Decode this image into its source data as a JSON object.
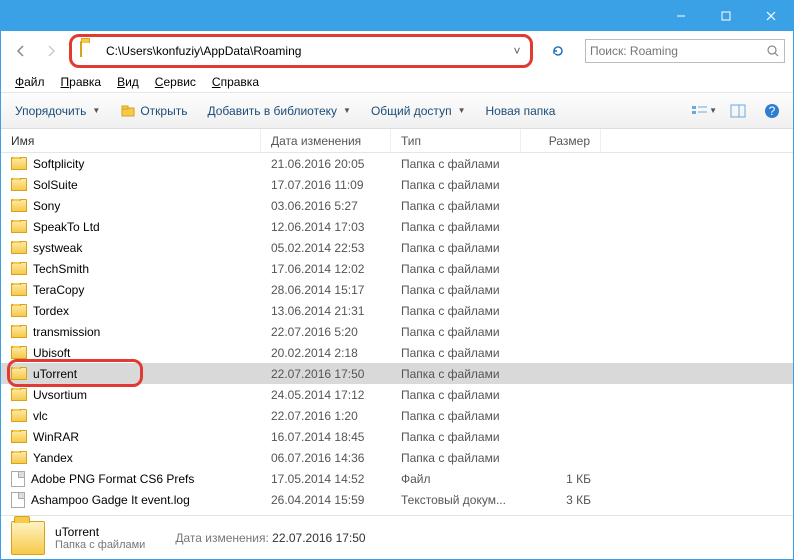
{
  "address": "C:\\Users\\konfuziy\\AppData\\Roaming",
  "search_placeholder": "Поиск: Roaming",
  "menu": {
    "file": "Файл",
    "edit": "Правка",
    "view": "Вид",
    "service": "Сервис",
    "help": "Справка"
  },
  "toolbar": {
    "organize": "Упорядочить",
    "open": "Открыть",
    "addlib": "Добавить в библиотеку",
    "share": "Общий доступ",
    "newfolder": "Новая папка"
  },
  "columns": {
    "name": "Имя",
    "date": "Дата изменения",
    "type": "Тип",
    "size": "Размер"
  },
  "rows": [
    {
      "icon": "folder",
      "name": "Softplicity",
      "date": "21.06.2016 20:05",
      "type": "Папка с файлами",
      "size": ""
    },
    {
      "icon": "folder",
      "name": "SolSuite",
      "date": "17.07.2016 11:09",
      "type": "Папка с файлами",
      "size": ""
    },
    {
      "icon": "folder",
      "name": "Sony",
      "date": "03.06.2016 5:27",
      "type": "Папка с файлами",
      "size": ""
    },
    {
      "icon": "folder",
      "name": "SpeakTo Ltd",
      "date": "12.06.2014 17:03",
      "type": "Папка с файлами",
      "size": ""
    },
    {
      "icon": "folder",
      "name": "systweak",
      "date": "05.02.2014 22:53",
      "type": "Папка с файлами",
      "size": ""
    },
    {
      "icon": "folder",
      "name": "TechSmith",
      "date": "17.06.2014 12:02",
      "type": "Папка с файлами",
      "size": ""
    },
    {
      "icon": "folder",
      "name": "TeraCopy",
      "date": "28.06.2014 15:17",
      "type": "Папка с файлами",
      "size": ""
    },
    {
      "icon": "folder",
      "name": "Tordex",
      "date": "13.06.2014 21:31",
      "type": "Папка с файлами",
      "size": ""
    },
    {
      "icon": "folder",
      "name": "transmission",
      "date": "22.07.2016 5:20",
      "type": "Папка с файлами",
      "size": ""
    },
    {
      "icon": "folder",
      "name": "Ubisoft",
      "date": "20.02.2014 2:18",
      "type": "Папка с файлами",
      "size": ""
    },
    {
      "icon": "folder",
      "name": "uTorrent",
      "date": "22.07.2016 17:50",
      "type": "Папка с файлами",
      "size": "",
      "selected": true
    },
    {
      "icon": "folder",
      "name": "Uvsortium",
      "date": "24.05.2014 17:12",
      "type": "Папка с файлами",
      "size": ""
    },
    {
      "icon": "folder",
      "name": "vlc",
      "date": "22.07.2016 1:20",
      "type": "Папка с файлами",
      "size": ""
    },
    {
      "icon": "folder",
      "name": "WinRAR",
      "date": "16.07.2014 18:45",
      "type": "Папка с файлами",
      "size": ""
    },
    {
      "icon": "folder",
      "name": "Yandex",
      "date": "06.07.2016 14:36",
      "type": "Папка с файлами",
      "size": ""
    },
    {
      "icon": "file",
      "name": "Adobe PNG Format CS6 Prefs",
      "date": "17.05.2014 14:52",
      "type": "Файл",
      "size": "1 КБ"
    },
    {
      "icon": "file",
      "name": "Ashampoo Gadge It event.log",
      "date": "26.04.2014 15:59",
      "type": "Текстовый докум...",
      "size": "3 КБ"
    }
  ],
  "status": {
    "name": "uTorrent",
    "date_label": "Дата изменения:",
    "date_value": "22.07.2016 17:50",
    "sub": "Папка с файлами"
  }
}
